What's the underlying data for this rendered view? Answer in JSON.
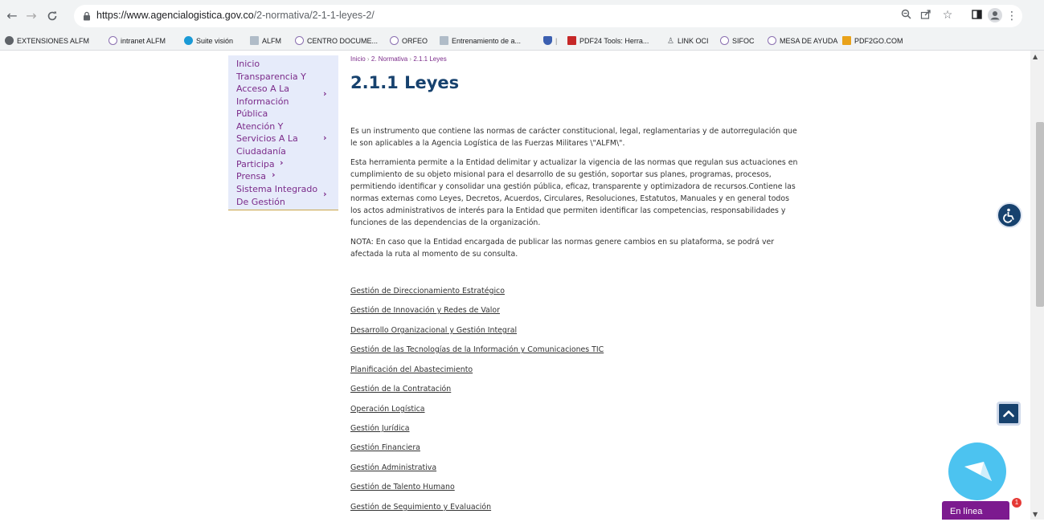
{
  "browser": {
    "url_host": "https://www.agencialogistica.gov.co",
    "url_path": "/2-normativa/2-1-1-leyes-2/"
  },
  "bookmarks": [
    {
      "label": "EXTENSIONES ALFM",
      "icon": "globe-icon",
      "color": "#5f6368"
    },
    {
      "label": "intranet ALFM",
      "icon": "site-icon",
      "color": "#8a6fb0"
    },
    {
      "label": "Suite visión",
      "icon": "suite-icon",
      "color": "#1a9ad6"
    },
    {
      "label": "ALFM",
      "icon": "alfm-icon",
      "color": "#7a8a9a"
    },
    {
      "label": "CENTRO DOCUME...",
      "icon": "site-icon",
      "color": "#8a6fb0"
    },
    {
      "label": "ORFEO",
      "icon": "site-icon",
      "color": "#8a6fb0"
    },
    {
      "label": "Entrenamiento de a...",
      "icon": "alfm-icon",
      "color": "#7a8a9a"
    },
    {
      "label": "",
      "icon": "shield-icon",
      "color": "#3b5fb0"
    },
    {
      "label": "PDF24 Tools: Herra...",
      "icon": "pdf24-icon",
      "color": "#c62828"
    },
    {
      "label": "LINK OCI",
      "icon": "link-icon",
      "color": "#5f6368"
    },
    {
      "label": "SIFOC",
      "icon": "site-icon",
      "color": "#8a6fb0"
    },
    {
      "label": "MESA DE AYUDA",
      "icon": "site-icon",
      "color": "#8a6fb0"
    },
    {
      "label": "PDF2GO.COM",
      "icon": "pdf2go-icon",
      "color": "#e9a21a"
    }
  ],
  "side_menu": {
    "inicio": "Inicio",
    "transparencia": [
      "Transparencia Y",
      "Acceso A La",
      "Información",
      "Pública"
    ],
    "atencion": [
      "Atención Y",
      "Servicios A La",
      "Ciudadanía"
    ],
    "participa": "Participa",
    "prensa": "Prensa",
    "sistema": [
      "Sistema Integrado",
      "De Gestión"
    ]
  },
  "breadcrumb": {
    "inicio": "Inicio",
    "normativa": "2. Normativa",
    "current": "2.1.1 Leyes"
  },
  "page": {
    "title": "2.1.1 Leyes",
    "para1": "Es un instrumento que contiene las normas de carácter constitucional, legal, reglamentarias y de autorregulación que le son aplicables a la Agencia Logística de las Fuerzas Militares \\\"ALFM\\\".",
    "para2": "Esta herramienta permite a la Entidad delimitar y actualizar la vigencia de las normas que regulan sus actuaciones en cumplimiento de su objeto misional para el desarrollo de su gestión, soportar sus planes, programas, procesos, permitiendo identificar y consolidar una gestión pública, eficaz, transparente y optimizadora de recursos.Contiene las normas externas como Leyes, Decretos, Acuerdos, Circulares, Resoluciones, Estatutos, Manuales y en general todos los actos administrativos de interés para la Entidad que permiten identificar las competencias, responsabilidades y funciones de las dependencias de la organización.",
    "para3": "NOTA:  En caso que la Entidad encargada de publicar las normas genere cambios en su plataforma, se podrá ver afectada la ruta al momento de su consulta."
  },
  "process_links": [
    "Gestión de Direccionamiento Estratégico",
    "Gestión de Innovación y Redes de Valor",
    "Desarrollo Organizacional y Gestión Integral",
    "Gestión de las Tecnologías de la Información y Comunicaciones TIC",
    "Planificación del Abastecimiento",
    "Gestión de la Contratación",
    "Operación Logística",
    "Gestión Jurídica",
    "Gestión Financiera",
    "Gestión Administrativa",
    "Gestión de Talento Humano",
    "Gestión de Seguimiento y Evaluación"
  ],
  "chat": {
    "status": "En línea",
    "badge": "1"
  },
  "colors": {
    "menu_text": "#7b2b8a",
    "title": "#17426e",
    "chat_tab": "#7c1a8f",
    "chat_bubble": "#4cc3f0"
  }
}
